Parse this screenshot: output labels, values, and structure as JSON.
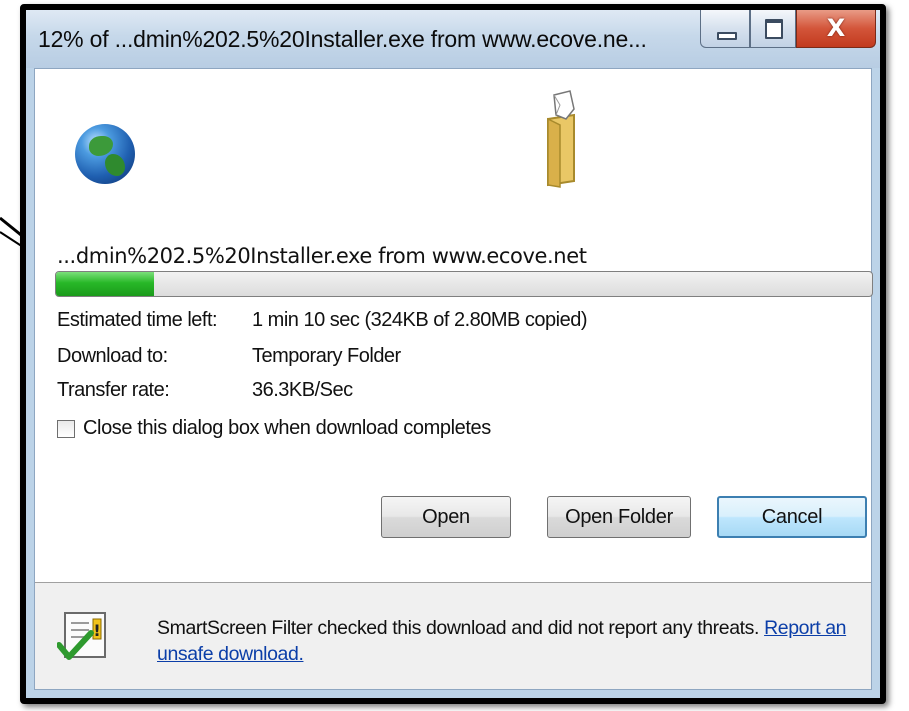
{
  "window": {
    "title": "12% of ...dmin%202.5%20Installer.exe from www.ecove.ne...",
    "controls": {
      "minimize": "",
      "maximize": "",
      "close": "X"
    }
  },
  "download": {
    "filename": "...dmin%202.5%20Installer.exe from www.ecove.net",
    "progress_fraction": 0.12,
    "progress_color": "#28b828",
    "estimated_time_label": "Estimated time left:",
    "estimated_time_value": "1 min 10 sec (324KB of 2.80MB copied)",
    "download_to_label": "Download to:",
    "download_to_value": "Temporary Folder",
    "transfer_rate_label": "Transfer rate:",
    "transfer_rate_value": "36.3KB/Sec"
  },
  "close_checkbox": {
    "label": "Close this dialog box when download completes",
    "checked": false
  },
  "buttons": {
    "open": "Open",
    "open_folder": "Open Folder",
    "cancel": "Cancel"
  },
  "smartscreen": {
    "text": "SmartScreen Filter checked this download and did not report any threats.",
    "link": "Report an unsafe download."
  },
  "icons": {
    "globe": "globe-icon",
    "folder": "folder-icon",
    "smartscreen": "smartscreen-shield-icon"
  }
}
